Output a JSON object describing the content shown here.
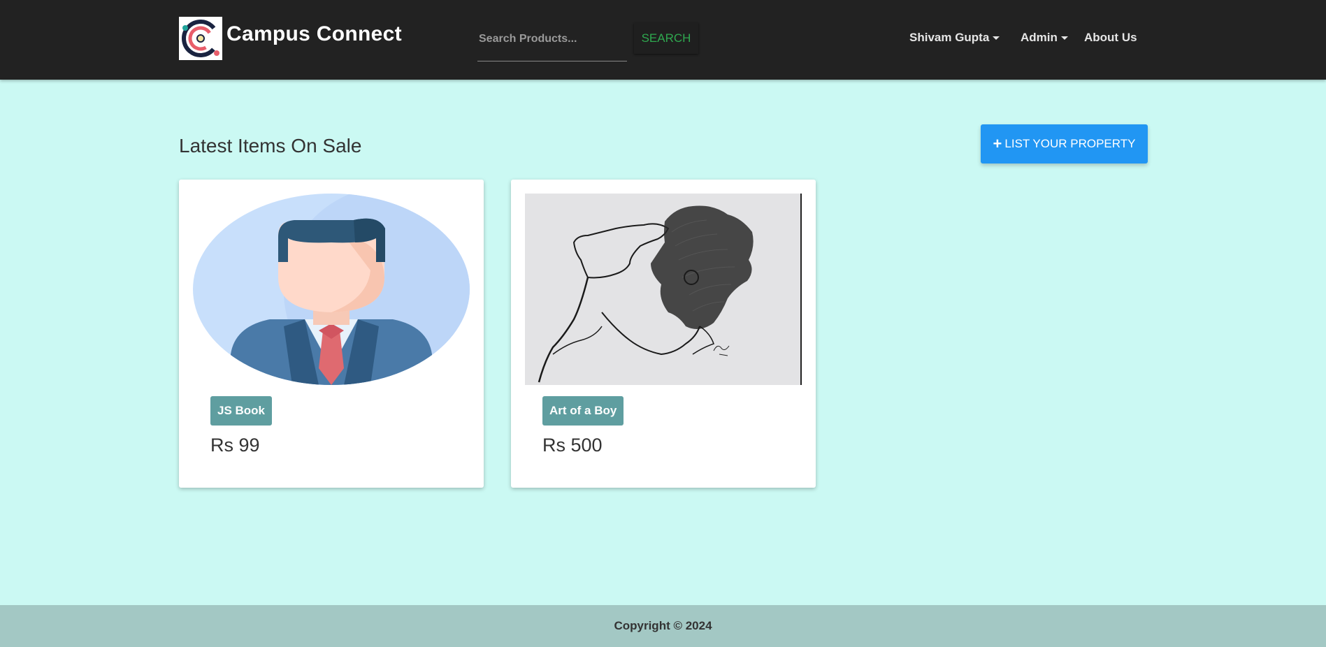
{
  "header": {
    "brand_name": "Campus Connect",
    "logo_icon": "campus-connect-logo-icon",
    "search": {
      "placeholder": "Search Products...",
      "button_label": "SEARCH"
    },
    "nav": {
      "user_label": "Shivam Gupta",
      "admin_label": "Admin",
      "about_label": "About Us"
    }
  },
  "main": {
    "title": "Latest Items On Sale",
    "list_button": {
      "icon": "plus-icon",
      "label": "LIST YOUR PROPERTY"
    },
    "items": [
      {
        "title": "JS Book",
        "price": "Rs 99",
        "image": "businessman-avatar-illustration"
      },
      {
        "title": "Art of a Boy",
        "price": "Rs 500",
        "image": "pen-sketch-of-boy"
      }
    ]
  },
  "footer": {
    "copyright": "Copyright © 2024"
  },
  "colors": {
    "navbar": "#222222",
    "page_background": "#cbf9f3",
    "accent_button": "#2196f3",
    "tag": "#5f9ea0",
    "footer": "#a3c8c4",
    "search_text": "#2fa84f"
  }
}
